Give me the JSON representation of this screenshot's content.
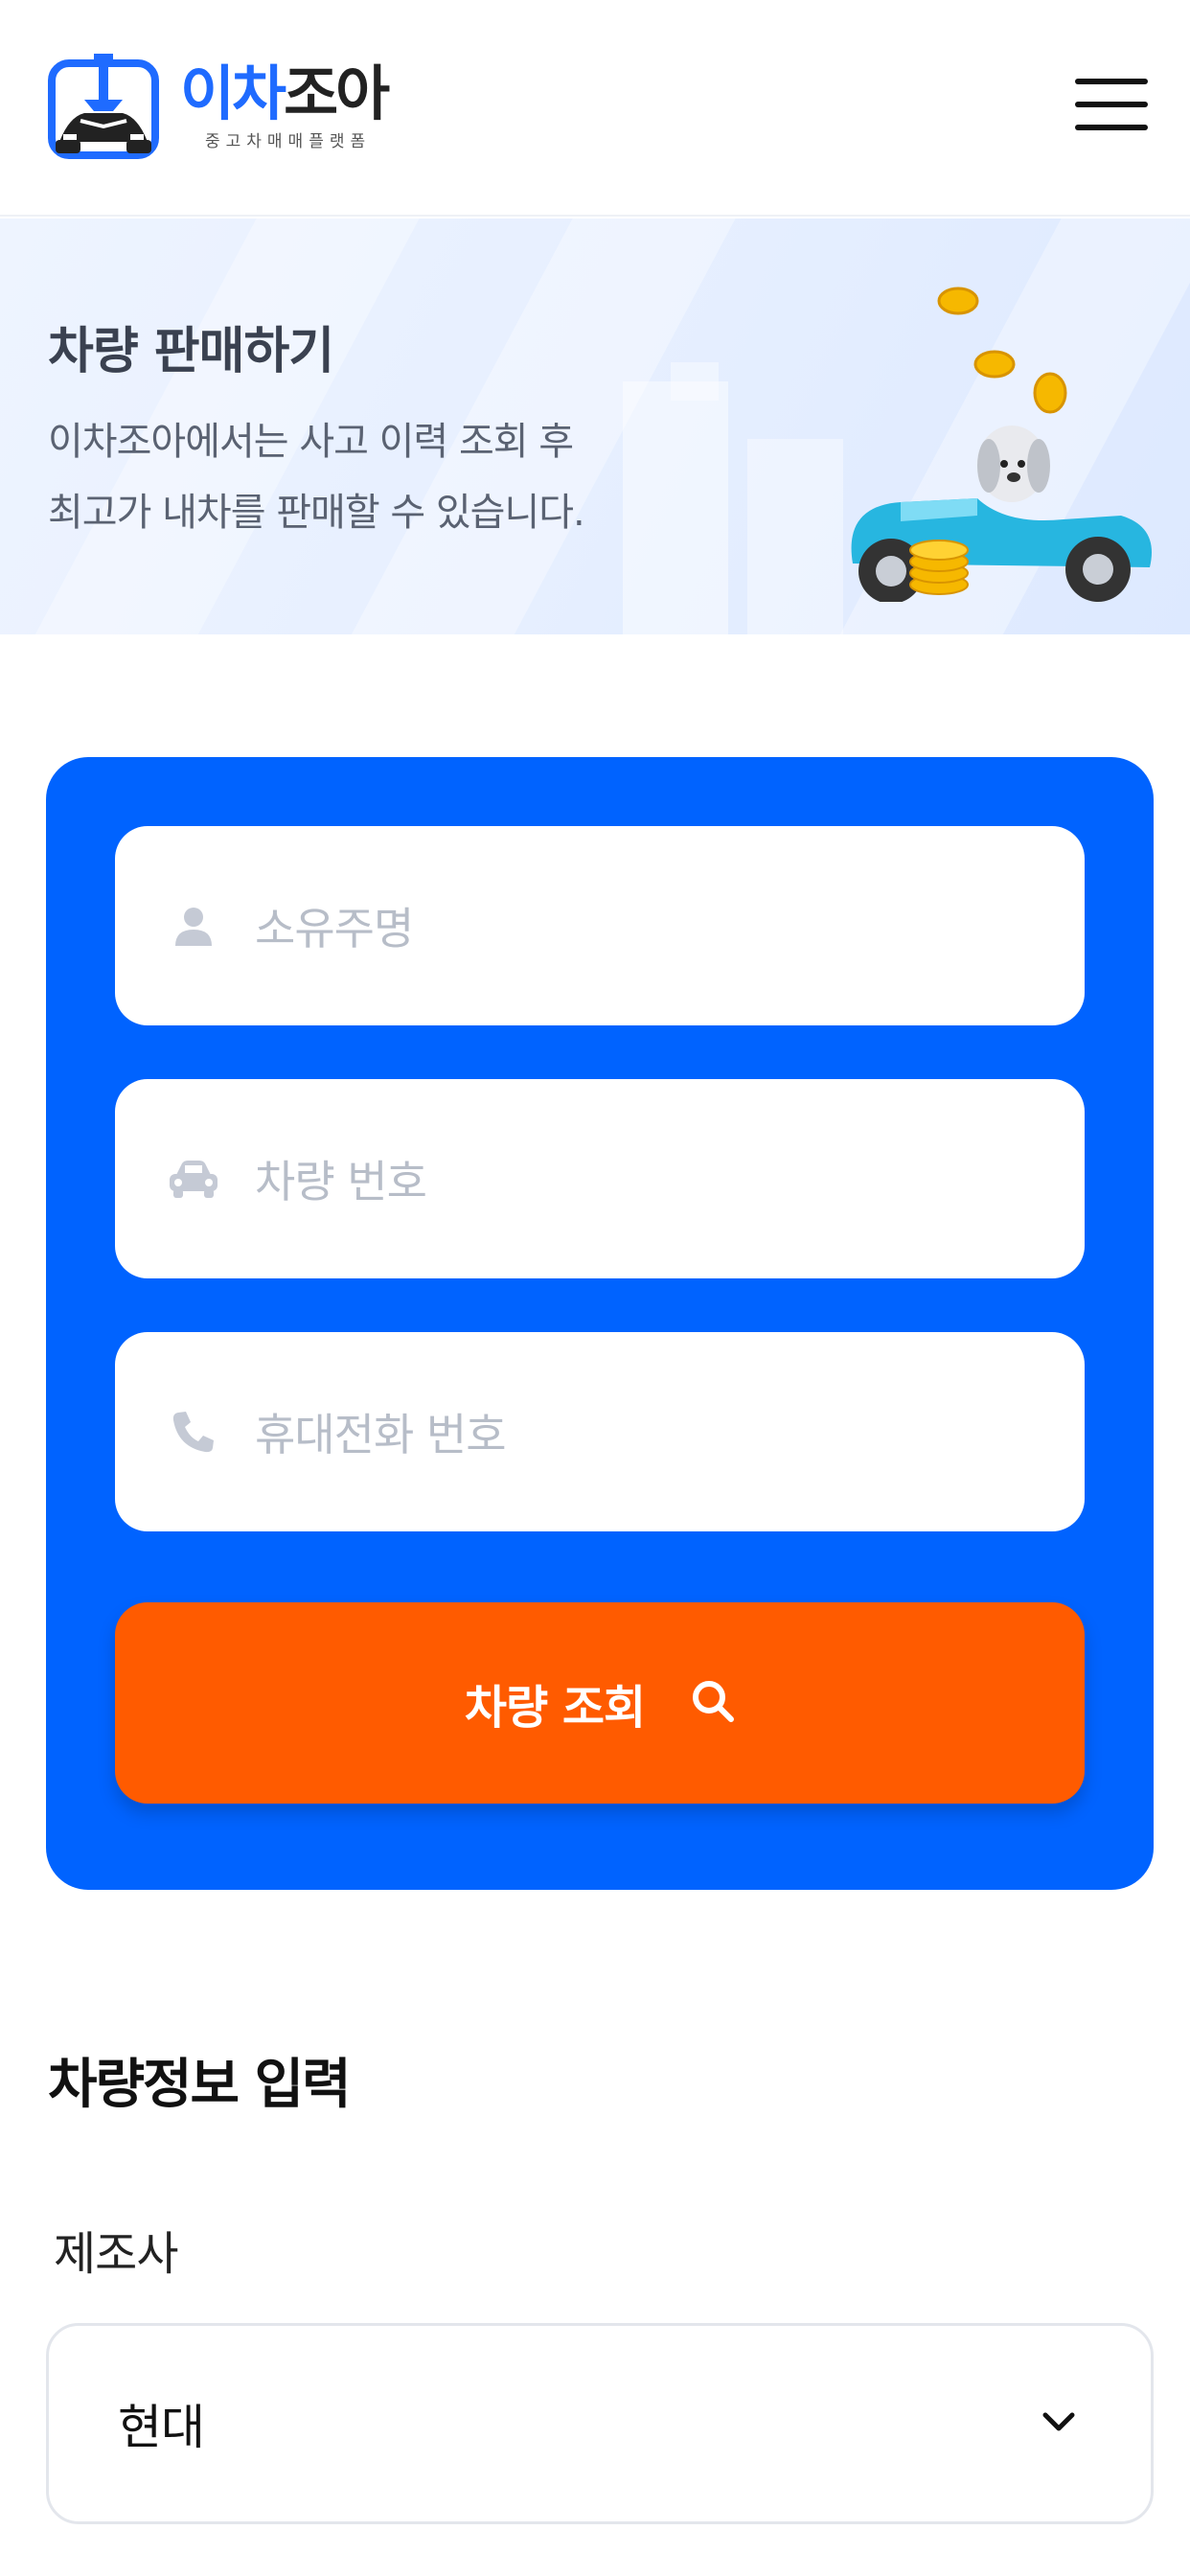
{
  "header": {
    "logo_prefix": "이차",
    "logo_suffix": "조아",
    "logo_subtitle": "중고차매매플랫폼",
    "menu_icon": "hamburger-menu-icon"
  },
  "hero": {
    "title": "차량 판매하기",
    "desc_line1": "이차조아에서는 사고 이력 조회 후",
    "desc_line2": "최고가 내차를 판매할 수 있습니다.",
    "illustration": "dog-driving-car-with-coins"
  },
  "form": {
    "owner_name_placeholder": "소유주명",
    "car_number_placeholder": "차량 번호",
    "phone_placeholder": "휴대전화 번호",
    "search_button_label": "차량 조회",
    "colors": {
      "card": "#0063ff",
      "button": "#ff5b00",
      "input_bg": "#ffffff"
    }
  },
  "vehicle_info": {
    "section_title": "차량정보 입력",
    "manufacturer_label": "제조사",
    "manufacturer_value": "현대"
  }
}
